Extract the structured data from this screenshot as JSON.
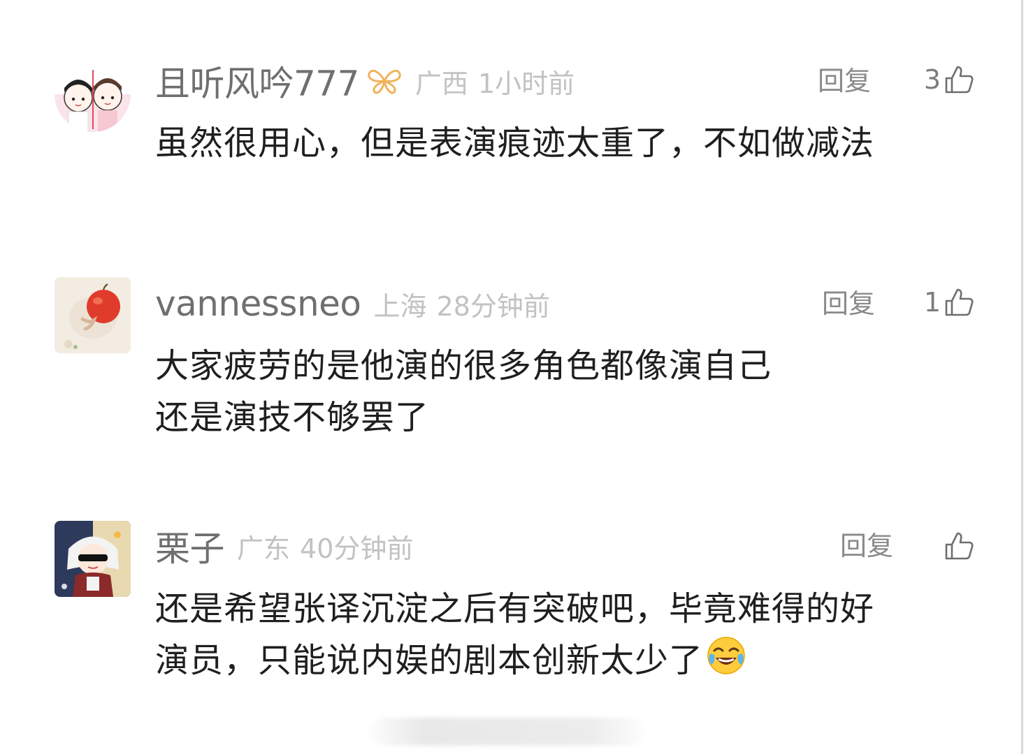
{
  "comments": [
    {
      "username": "且听风吟777",
      "location": "广西",
      "time": "1小时前",
      "reply_label": "回复",
      "likes": "3",
      "text_lines": [
        "虽然很用心，但是表演痕迹太重了，不如做减法"
      ],
      "avatar_icon": "couple-cartoon-avatar",
      "badge_icon": "butterfly-icon"
    },
    {
      "username": "vannessneo",
      "location": "上海",
      "time": "28分钟前",
      "reply_label": "回复",
      "likes": "1",
      "text_lines": [
        "大家疲劳的是他演的很多角色都像演自己",
        "还是演技不够罢了"
      ],
      "avatar_icon": "apple-avatar"
    },
    {
      "username": "栗子",
      "location": "广东",
      "time": "40分钟前",
      "reply_label": "回复",
      "likes": "",
      "text_lines": [
        "还是希望张译沉淀之后有突破吧，毕竟难得的好",
        "演员，只能说内娱的剧本创新太少了"
      ],
      "avatar_icon": "anime-sunglasses-avatar",
      "trailing_emoji": "laugh-cry-emoji"
    }
  ],
  "colors": {
    "username": "#6f6f6f",
    "meta": "#c2c2c2",
    "text": "#1f1f1f",
    "badge": "#f0b25a"
  }
}
